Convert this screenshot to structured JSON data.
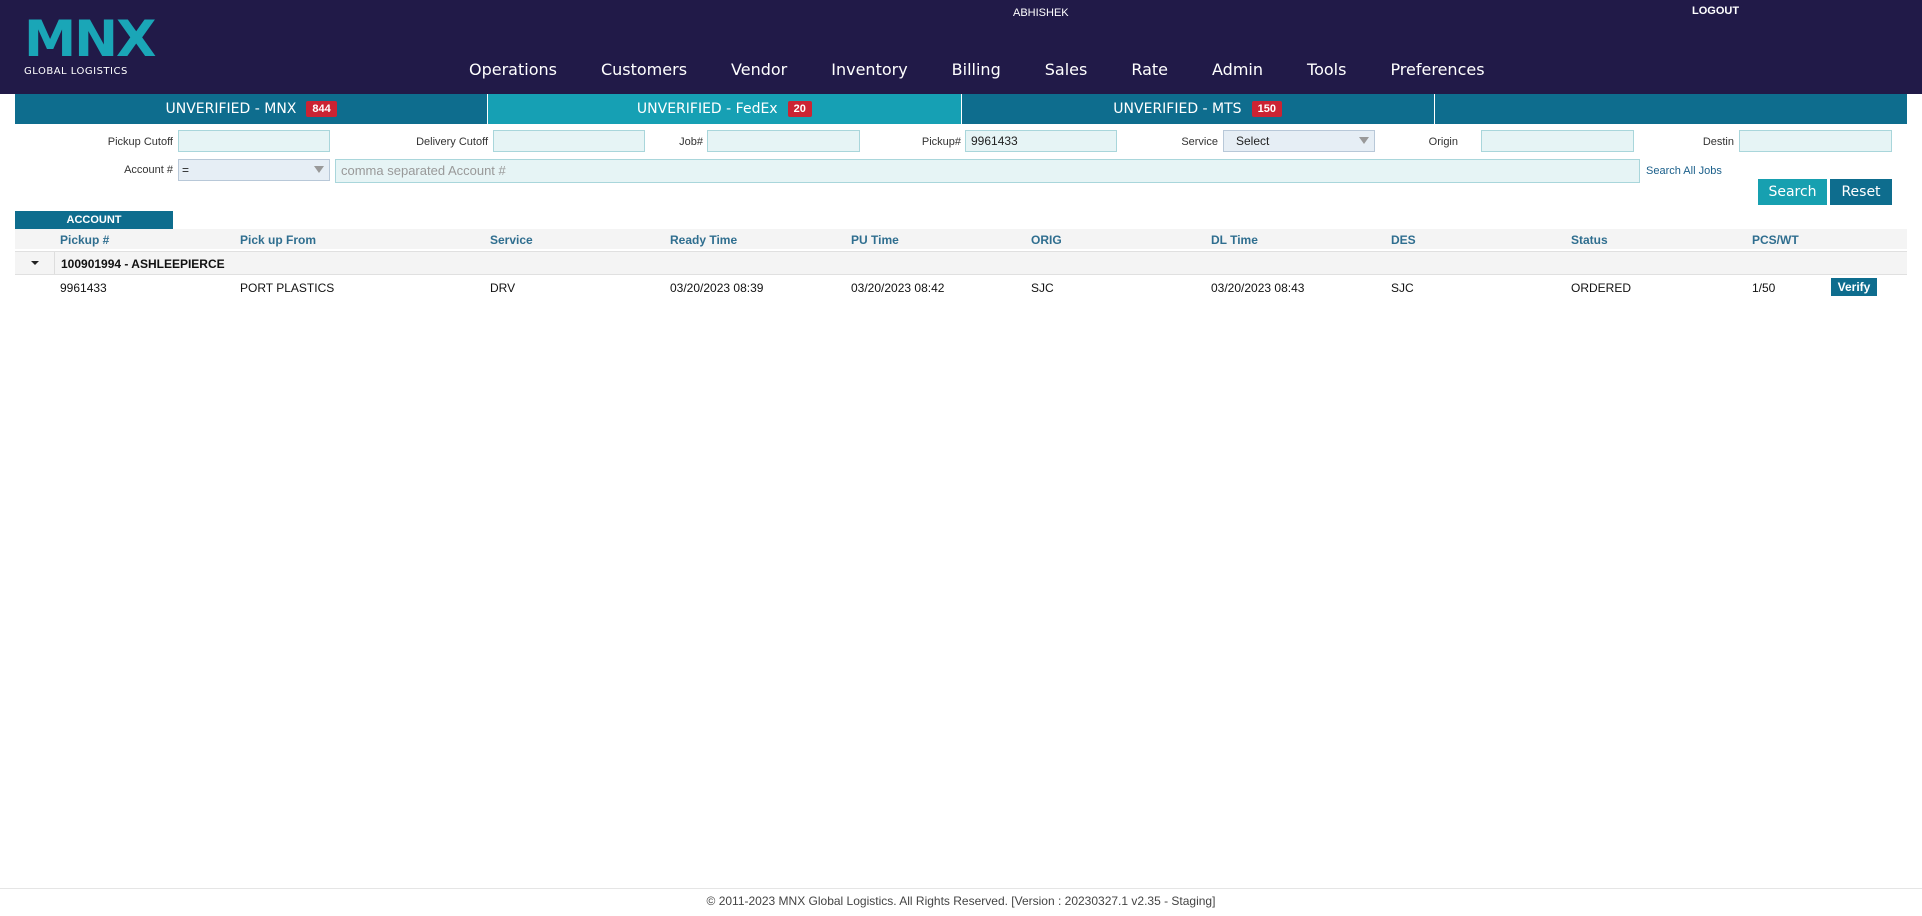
{
  "header": {
    "logo_text": "MNX",
    "logo_sub": "GLOBAL LOGISTICS",
    "user_name": "ABHISHEK",
    "logout_label": "LOGOUT",
    "nav": [
      "Operations",
      "Customers",
      "Vendor",
      "Inventory",
      "Billing",
      "Sales",
      "Rate",
      "Admin",
      "Tools",
      "Preferences"
    ]
  },
  "tabs": [
    {
      "label": "UNVERIFIED - MNX",
      "count": "844",
      "active": false
    },
    {
      "label": "UNVERIFIED - FedEx",
      "count": "20",
      "active": true
    },
    {
      "label": "UNVERIFIED - MTS",
      "count": "150",
      "active": false
    },
    {
      "label": "",
      "count": "",
      "active": false
    }
  ],
  "filters": {
    "pickup_cutoff_label": "Pickup Cutoff",
    "pickup_cutoff_value": "",
    "delivery_cutoff_label": "Delivery Cutoff",
    "delivery_cutoff_value": "",
    "job_label": "Job#",
    "job_value": "",
    "pickup_label": "Pickup#",
    "pickup_value": "9961433",
    "service_label": "Service",
    "service_value": "Select",
    "origin_label": "Origin",
    "origin_value": "",
    "destin_label": "Destin",
    "destin_value": "",
    "account_label": "Account #",
    "account_operator": "=",
    "account_placeholder": "comma separated Account #",
    "search_all_jobs": "Search All Jobs",
    "search_button": "Search",
    "reset_button": "Reset"
  },
  "table": {
    "group_tag": "ACCOUNT",
    "columns": [
      "Pickup #",
      "Pick up From",
      "Service",
      "Ready Time",
      "PU Time",
      "ORIG",
      "DL Time",
      "DES",
      "Status",
      "PCS/WT"
    ],
    "group_label": "100901994 - ASHLEEPIERCE",
    "rows": [
      {
        "pickup": "9961433",
        "pickup_from": "PORT PLASTICS",
        "service": "DRV",
        "ready_time": "03/20/2023 08:39",
        "pu_time": "03/20/2023 08:42",
        "orig": "SJC",
        "dl_time": "03/20/2023 08:43",
        "des": "SJC",
        "status": "ORDERED",
        "pcs_wt": "1/50",
        "action": "Verify"
      }
    ]
  },
  "footer": {
    "text": "© 2011-2023 MNX Global Logistics. All Rights Reserved. [Version : 20230327.1 v2.35 - Staging]"
  }
}
